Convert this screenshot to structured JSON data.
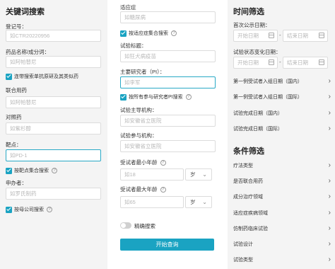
{
  "left": {
    "title": "关键词搜索",
    "registration_no": {
      "label": "登记号：",
      "placeholder": "如CTR20220956"
    },
    "drug_name": {
      "label": "药品名称/成分词：",
      "placeholder": "如阿帕替尼"
    },
    "drug_check": "连带搜索单抗原研及其类似药",
    "combo_drug": {
      "label": "联合用药",
      "placeholder": "如阿帕替尼"
    },
    "control_drug": {
      "label": "对照药",
      "placeholder": "如紫杉醇"
    },
    "target": {
      "label": "靶点：",
      "value": "如PD-1"
    },
    "target_check": "按靶点集合搜索",
    "sponsor": {
      "label": "申办者：",
      "placeholder": "如罗氏制药"
    },
    "sponsor_check": "按母公司搜索"
  },
  "middle": {
    "indication": {
      "label": "适应症",
      "placeholder": "如糖尿病"
    },
    "indication_check": "按适应症集合搜索",
    "trial_title": {
      "label": "试验标题：",
      "placeholder": "如狂犬病疫苗"
    },
    "pi": {
      "label": "主要研究者（PI）：",
      "value": "如李军"
    },
    "pi_check": "按所有参与研究者PI搜索",
    "lead_org": {
      "label": "试验主导机构：",
      "placeholder": "如安徽省立医院"
    },
    "participant_org": {
      "label": "试验参与机构：",
      "placeholder": "如安徽省立医院"
    },
    "min_age": {
      "label": "受试者最小年龄",
      "placeholder": "如18",
      "unit": "岁"
    },
    "max_age": {
      "label": "受试者最大年龄",
      "placeholder": "如65",
      "unit": "岁"
    },
    "exact_search": "精确搜索",
    "search_button": "开始查询"
  },
  "right": {
    "time_title": "时间筛选",
    "first_public": {
      "label": "首次公示日期：",
      "start": "开始日期",
      "end": "结束日期",
      "separator": "-"
    },
    "status_change": {
      "label": "试验状态变化日期：",
      "start": "开始日期",
      "end": "结束日期",
      "separator": "-"
    },
    "time_rows": [
      "第一例受试者入组日期（国内）",
      "第一例受试者入组日期（国际）",
      "试验完成日期（国内）",
      "试验完成日期（国际）"
    ],
    "condition_title": "条件筛选",
    "condition_rows": [
      "疗法类型",
      "是否联合用药",
      "成分治疗领域",
      "适应症疾病领域",
      "仿制药临床试验",
      "试验设计",
      "试验类型"
    ],
    "accent_color": "#1aa3c2"
  }
}
